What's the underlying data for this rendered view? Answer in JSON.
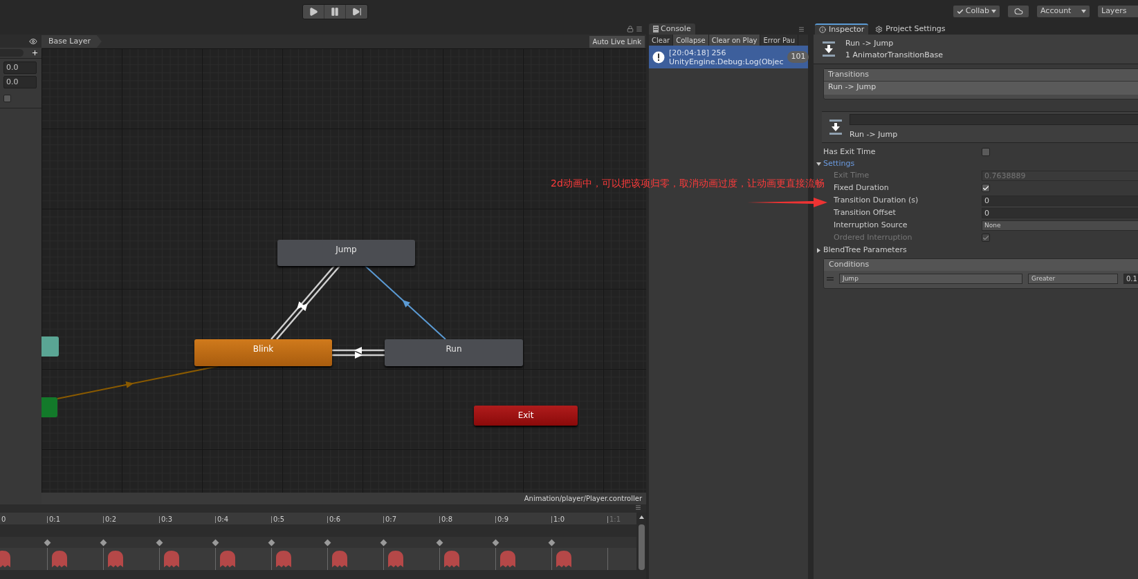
{
  "toolbar": {
    "right_buttons": [
      {
        "kind": "collab",
        "label": "Collab"
      },
      {
        "kind": "cloud"
      },
      {
        "kind": "account",
        "label": "Account"
      },
      {
        "kind": "layers",
        "label": "Layers"
      }
    ]
  },
  "animator": {
    "breadcrumb": "Base Layer",
    "live_link": "Auto Live Link",
    "parameters": [
      {
        "kind": "float",
        "value": "0.0"
      },
      {
        "kind": "float",
        "value": "0.0"
      },
      {
        "kind": "bool",
        "checked": false
      }
    ],
    "states": [
      {
        "kind": "normal",
        "label": "Jump"
      },
      {
        "kind": "default",
        "label": "Blink"
      },
      {
        "kind": "normal",
        "label": "Run"
      },
      {
        "kind": "exit",
        "label": "Exit"
      },
      {
        "kind": "any"
      },
      {
        "kind": "entry"
      }
    ],
    "transitions": [
      {
        "kind": "pair",
        "selected": false
      },
      {
        "kind": "single",
        "selected": true
      },
      {
        "kind": "pair",
        "selected": false
      },
      {
        "kind": "default",
        "selected": false
      }
    ],
    "path": "Animation/player/Player.controller"
  },
  "annotation": "2d动画中，可以把该项归零，取消动画过度，让动画更直接流畅",
  "timeline": {
    "ticks": [
      {
        "label": "0",
        "dimmed": false
      },
      {
        "label": "0:1",
        "dimmed": false
      },
      {
        "label": "0:2",
        "dimmed": false
      },
      {
        "label": "0:3",
        "dimmed": false
      },
      {
        "label": "0:4",
        "dimmed": false
      },
      {
        "label": "0:5",
        "dimmed": false
      },
      {
        "label": "0:6",
        "dimmed": false
      },
      {
        "label": "0:7",
        "dimmed": false
      },
      {
        "label": "0:8",
        "dimmed": false
      },
      {
        "label": "0:9",
        "dimmed": false
      },
      {
        "label": "1:0",
        "dimmed": false
      },
      {
        "label": "1:1",
        "dimmed": true
      }
    ]
  },
  "console": {
    "title": "Console",
    "buttons": [
      {
        "label": "Clear",
        "selected": false
      },
      {
        "label": "Collapse",
        "selected": true
      },
      {
        "label": "Clear on Play",
        "selected": true
      },
      {
        "label": "Error Pau",
        "selected": false
      }
    ],
    "entries": [
      {
        "lines": [
          "[20:04:18] 256",
          "UnityEngine.Debug:Log(Objec"
        ],
        "count": "101",
        "selected": true
      }
    ]
  },
  "inspector": {
    "tabs": [
      {
        "label": "Inspector",
        "kind": "inspector",
        "selected": true
      },
      {
        "label": "Project Settings",
        "kind": "settings",
        "selected": false
      }
    ],
    "title": "Run -> Jump",
    "subtitle": "1 AnimatorTransitionBase",
    "transitions_list": {
      "title": "Transitions",
      "items": [
        "Run -> Jump"
      ]
    },
    "transition_name": "Run -> Jump",
    "has_exit_time": {
      "label": "Has Exit Time",
      "checked": false
    },
    "settings": {
      "label": "Settings",
      "expanded": true,
      "rows": [
        {
          "kind": "field",
          "label": "Exit Time",
          "value": "0.7638889",
          "disabled": true
        },
        {
          "kind": "checkbox",
          "label": "Fixed Duration",
          "checked": true,
          "disabled": false
        },
        {
          "kind": "field",
          "label": "Transition Duration (s)",
          "value": "0",
          "disabled": false
        },
        {
          "kind": "field",
          "label": "Transition Offset",
          "value": "0",
          "disabled": false
        },
        {
          "kind": "dropdown",
          "label": "Interruption Source",
          "value": "None",
          "disabled": false
        },
        {
          "kind": "checkbox",
          "label": "Ordered Interruption",
          "checked": true,
          "disabled": true
        }
      ]
    },
    "blendtree": {
      "label": "BlendTree Parameters",
      "expanded": false
    },
    "conditions": {
      "title": "Conditions",
      "rows": [
        {
          "parameter": "Jump",
          "mode": "Greater",
          "value": "0.1"
        }
      ]
    }
  }
}
